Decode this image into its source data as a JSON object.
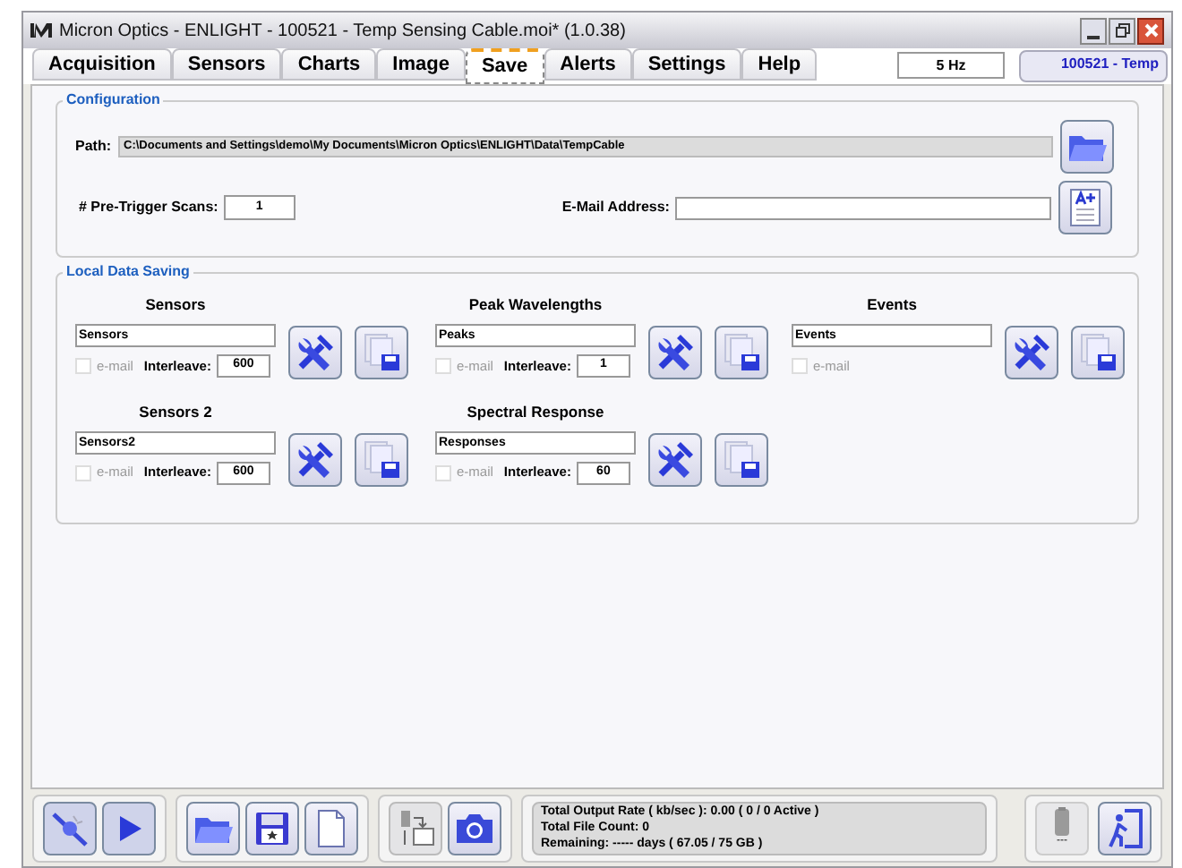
{
  "window": {
    "title": "Micron Optics - ENLIGHT - 100521 - Temp Sensing Cable.moi* (1.0.38)"
  },
  "tabs": [
    {
      "label": "Acquisition",
      "selected": false
    },
    {
      "label": "Sensors",
      "selected": false
    },
    {
      "label": "Charts",
      "selected": false
    },
    {
      "label": "Image",
      "selected": false
    },
    {
      "label": "Save",
      "selected": true
    },
    {
      "label": "Alerts",
      "selected": false
    },
    {
      "label": "Settings",
      "selected": false
    },
    {
      "label": "Help",
      "selected": false
    }
  ],
  "rate": "5 Hz",
  "project": "100521 - Temp",
  "configuration": {
    "title": "Configuration",
    "path_label": "Path:",
    "path": "C:\\Documents and Settings\\demo\\My Documents\\Micron Optics\\ENLIGHT\\Data\\TempCable",
    "pretrigger_label": "# Pre-Trigger Scans:",
    "pretrigger": "1",
    "email_label": "E-Mail Address:"
  },
  "local_saving": {
    "title": "Local Data Saving",
    "groups": [
      {
        "title": "Sensors",
        "name": "Sensors",
        "email_label": "e-mail",
        "email": false,
        "interleave_label": "Interleave:",
        "interleave": "600"
      },
      {
        "title": "Peak Wavelengths",
        "name": "Peaks",
        "email_label": "e-mail",
        "email": false,
        "interleave_label": "Interleave:",
        "interleave": "1"
      },
      {
        "title": "Events",
        "name": "Events",
        "email_label": "e-mail",
        "email": false
      },
      {
        "title": "Sensors 2",
        "name": "Sensors2",
        "email_label": "e-mail",
        "email": false,
        "interleave_label": "Interleave:",
        "interleave": "600"
      },
      {
        "title": "Spectral Response",
        "name": "Responses",
        "email_label": "e-mail",
        "email": false,
        "interleave_label": "Interleave:",
        "interleave": "60"
      }
    ]
  },
  "status": {
    "lines": [
      "Total Output Rate ( kb/sec ): 0.00 ( 0 / 0 Active )",
      "Total File Count: 0",
      "Remaining: ----- days ( 67.05 / 75 GB )"
    ]
  },
  "battery_label": "---"
}
